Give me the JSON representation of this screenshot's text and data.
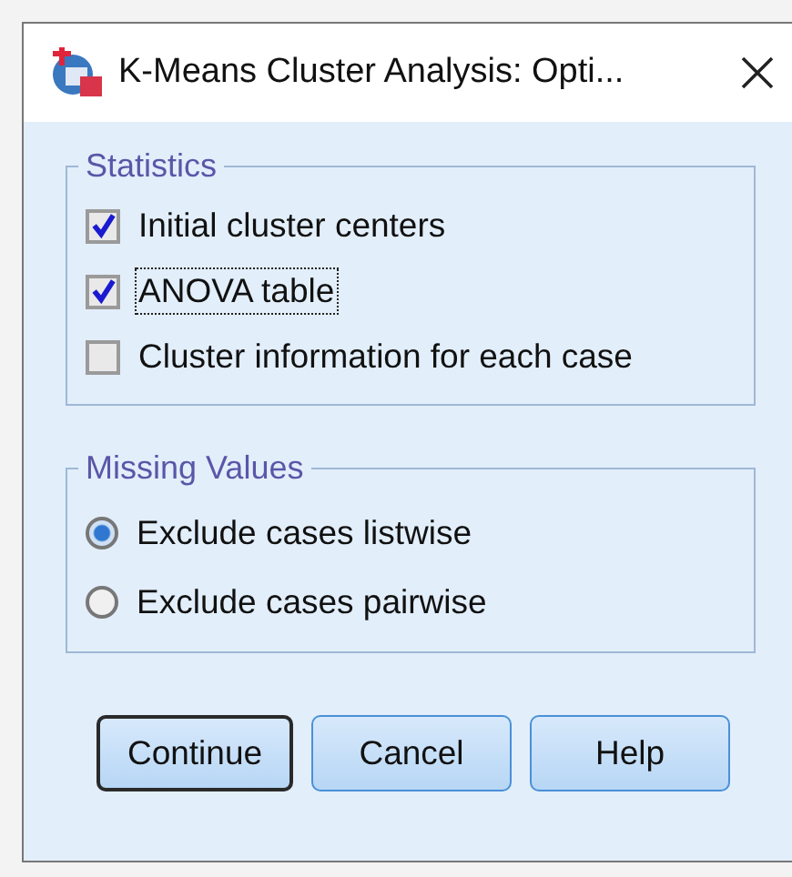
{
  "window": {
    "title": "K-Means Cluster Analysis: Opti..."
  },
  "statistics": {
    "title": "Statistics",
    "options": [
      {
        "label": "Initial cluster centers",
        "checked": true,
        "focused": false
      },
      {
        "label": "ANOVA table",
        "checked": true,
        "focused": true
      },
      {
        "label": "Cluster information for each case",
        "checked": false,
        "focused": false
      }
    ]
  },
  "missing_values": {
    "title": "Missing Values",
    "options": [
      {
        "label": "Exclude cases listwise",
        "selected": true
      },
      {
        "label": "Exclude cases pairwise",
        "selected": false
      }
    ]
  },
  "buttons": [
    {
      "label": "Continue",
      "default": true
    },
    {
      "label": "Cancel",
      "default": false
    },
    {
      "label": "Help",
      "default": false
    }
  ]
}
